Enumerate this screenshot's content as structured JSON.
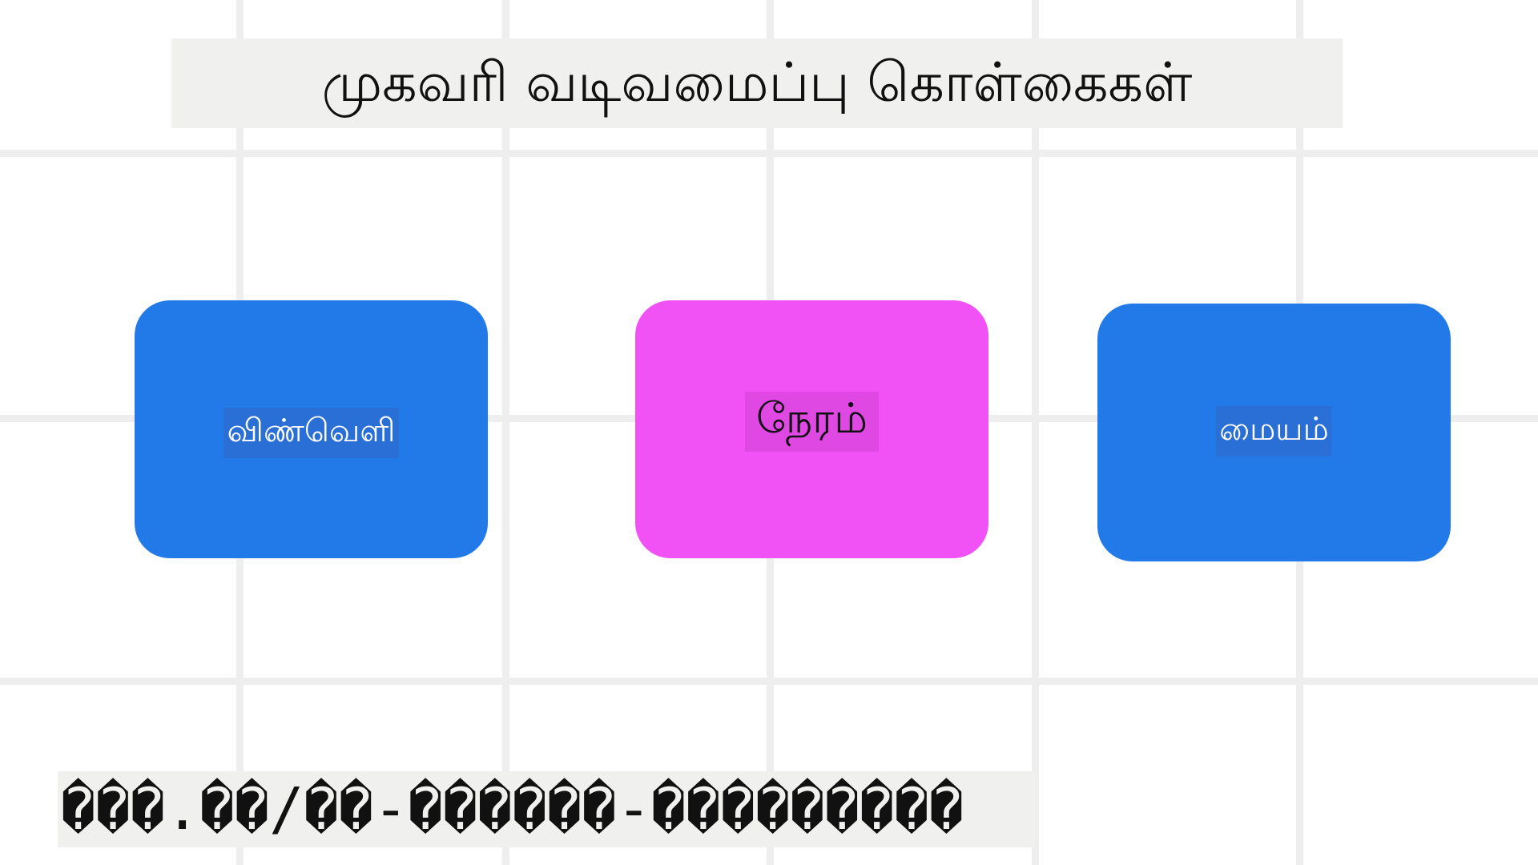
{
  "title": "முகவரி வடிவமைப்பு கொள்கைகள்",
  "nodes": [
    {
      "label": "விண்வெளி",
      "color": "#227ae8"
    },
    {
      "label": "நேரம்",
      "color": "#f152f5"
    },
    {
      "label": "மையம்",
      "color": "#227ae8"
    }
  ],
  "url_text": "���.��/��-������-���������"
}
